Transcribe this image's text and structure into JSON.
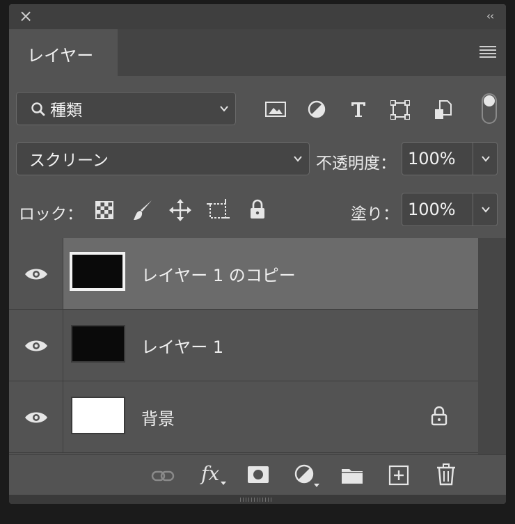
{
  "panel": {
    "close_glyph": "×",
    "collapse_glyph": "‹‹",
    "tab_label": "レイヤー",
    "menu_icon": "panel-menu-icon"
  },
  "filter": {
    "kind_label": "種類",
    "icons": [
      "pixel-filter-icon",
      "adjustment-filter-icon",
      "type-filter-icon",
      "shape-filter-icon",
      "smart-object-filter-icon"
    ],
    "toggle_icon": "filter-toggle-icon"
  },
  "blend": {
    "mode": "スクリーン",
    "opacity_label": "不透明度：",
    "opacity_value": "100%"
  },
  "lock": {
    "label": "ロック：",
    "icons": [
      "lock-transparent-pixels-icon",
      "lock-image-pixels-icon",
      "lock-position-icon",
      "lock-artboard-icon",
      "lock-all-icon"
    ],
    "fill_label": "塗り：",
    "fill_value": "100%"
  },
  "layers": [
    {
      "name": "レイヤー 1 のコピー",
      "visible": true,
      "thumb_color": "#0a0a0a",
      "active": true,
      "locked": false
    },
    {
      "name": "レイヤー 1",
      "visible": true,
      "thumb_color": "#0a0a0a",
      "active": false,
      "locked": false
    },
    {
      "name": "背景",
      "visible": true,
      "thumb_color": "#ffffff",
      "active": false,
      "locked": true
    }
  ],
  "footer": {
    "fx_label": "fx",
    "icons": [
      "link-layers-icon",
      "fx-icon",
      "add-mask-icon",
      "new-adjustment-icon",
      "new-group-icon",
      "new-layer-icon",
      "delete-layer-icon"
    ]
  }
}
